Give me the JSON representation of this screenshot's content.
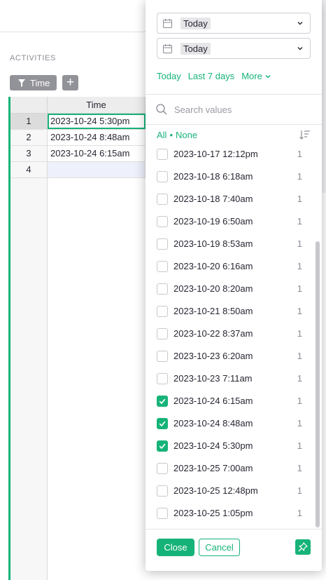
{
  "section": {
    "title": "ACTIVITIES"
  },
  "toolbar": {
    "filter_chip_label": "Time",
    "add_filter_label": "+"
  },
  "grid": {
    "column_header": "Time",
    "rows": [
      {
        "num": "1",
        "time": "2023-10-24 5:30pm"
      },
      {
        "num": "2",
        "time": "2023-10-24 8:48am"
      },
      {
        "num": "3",
        "time": "2023-10-24 6:15am"
      },
      {
        "num": "4",
        "time": ""
      }
    ]
  },
  "filter_popup": {
    "min_date": "Today",
    "max_date": "Today",
    "quick_options": {
      "today": "Today",
      "last7": "Last 7 days",
      "more": "More"
    },
    "search_placeholder": "Search values",
    "select_all": "All",
    "separator": "•",
    "select_none": "None",
    "values": [
      {
        "label": "2023-10-17 12:12pm",
        "count": "1",
        "checked": false
      },
      {
        "label": "2023-10-18 6:18am",
        "count": "1",
        "checked": false
      },
      {
        "label": "2023-10-18 7:40am",
        "count": "1",
        "checked": false
      },
      {
        "label": "2023-10-19 6:50am",
        "count": "1",
        "checked": false
      },
      {
        "label": "2023-10-19 8:53am",
        "count": "1",
        "checked": false
      },
      {
        "label": "2023-10-20 6:16am",
        "count": "1",
        "checked": false
      },
      {
        "label": "2023-10-20 8:20am",
        "count": "1",
        "checked": false
      },
      {
        "label": "2023-10-21 8:50am",
        "count": "1",
        "checked": false
      },
      {
        "label": "2023-10-22 8:37am",
        "count": "1",
        "checked": false
      },
      {
        "label": "2023-10-23 6:20am",
        "count": "1",
        "checked": false
      },
      {
        "label": "2023-10-23 7:11am",
        "count": "1",
        "checked": false
      },
      {
        "label": "2023-10-24 6:15am",
        "count": "1",
        "checked": true
      },
      {
        "label": "2023-10-24 8:48am",
        "count": "1",
        "checked": true
      },
      {
        "label": "2023-10-24 5:30pm",
        "count": "1",
        "checked": true
      },
      {
        "label": "2023-10-25 7:00am",
        "count": "1",
        "checked": false
      },
      {
        "label": "2023-10-25 12:48pm",
        "count": "1",
        "checked": false
      },
      {
        "label": "2023-10-25 1:05pm",
        "count": "1",
        "checked": false
      }
    ],
    "close_label": "Close",
    "cancel_label": "Cancel"
  },
  "colors": {
    "accent": "#16b378",
    "chip": "#929299",
    "selected_row": "#dcdcdc"
  }
}
